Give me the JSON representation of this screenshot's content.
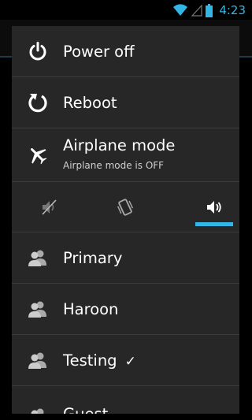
{
  "status_bar": {
    "time": "4:23"
  },
  "power_menu": {
    "power_off": {
      "label": "Power off",
      "icon": "power-icon"
    },
    "reboot": {
      "label": "Reboot",
      "icon": "reboot-icon"
    },
    "airplane": {
      "label": "Airplane mode",
      "status": "Airplane mode is OFF",
      "icon": "airplane-icon"
    },
    "sound_modes": [
      {
        "mode": "silent",
        "icon": "silent-icon",
        "selected": false
      },
      {
        "mode": "vibrate",
        "icon": "vibrate-icon",
        "selected": false
      },
      {
        "mode": "sound",
        "icon": "speaker-icon",
        "selected": true
      }
    ],
    "users": [
      {
        "name": "Primary",
        "checked": false
      },
      {
        "name": "Haroon",
        "checked": false
      },
      {
        "name": "Testing",
        "checked": true,
        "check_mark": "✓"
      },
      {
        "name": "Guest",
        "checked": false
      }
    ]
  },
  "colors": {
    "accent": "#33b5e5",
    "dialog_bg": "#272727",
    "divider": "#3b3b3b"
  }
}
